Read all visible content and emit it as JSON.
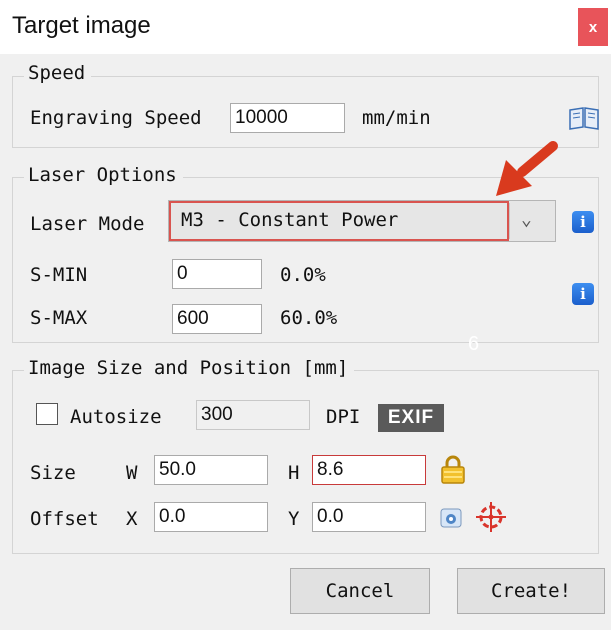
{
  "window": {
    "title": "Target image",
    "close_label": "x"
  },
  "speed": {
    "group_title": "Speed",
    "engraving_speed_label": "Engraving Speed",
    "engraving_speed_value": "10000",
    "unit": "mm/min",
    "help_icon": "book-icon"
  },
  "laser_options": {
    "group_title": "Laser Options",
    "laser_mode_label": "Laser Mode",
    "laser_mode_value": "M3 - Constant Power",
    "dropdown_glyph": "⌄",
    "info_glyph": "i",
    "smin_label": "S-MIN",
    "smin_value": "0",
    "smin_percent": "0.0%",
    "smax_label": "S-MAX",
    "smax_value": "600",
    "smax_percent": "60.0%"
  },
  "image_size": {
    "group_title": "Image Size and Position [mm]",
    "autosize_label": "Autosize",
    "autosize_checked": false,
    "dpi_value": "300",
    "dpi_label": "DPI",
    "exif_label": "EXIF",
    "size_label": "Size",
    "w_label": "W",
    "w_value": "50.0",
    "h_label": "H",
    "h_value": "8.6",
    "offset_label": "Offset",
    "x_label": "X",
    "x_value": "0.0",
    "y_label": "Y",
    "y_value": "0.0"
  },
  "buttons": {
    "cancel": "Cancel",
    "create": "Create!"
  },
  "annotation": {
    "overlay_text": "6",
    "arrow_color": "#d93a1e"
  },
  "colors": {
    "accent_red": "#d9544f",
    "info_blue": "#2b6fdc",
    "lock_gold": "#e8b21c"
  }
}
